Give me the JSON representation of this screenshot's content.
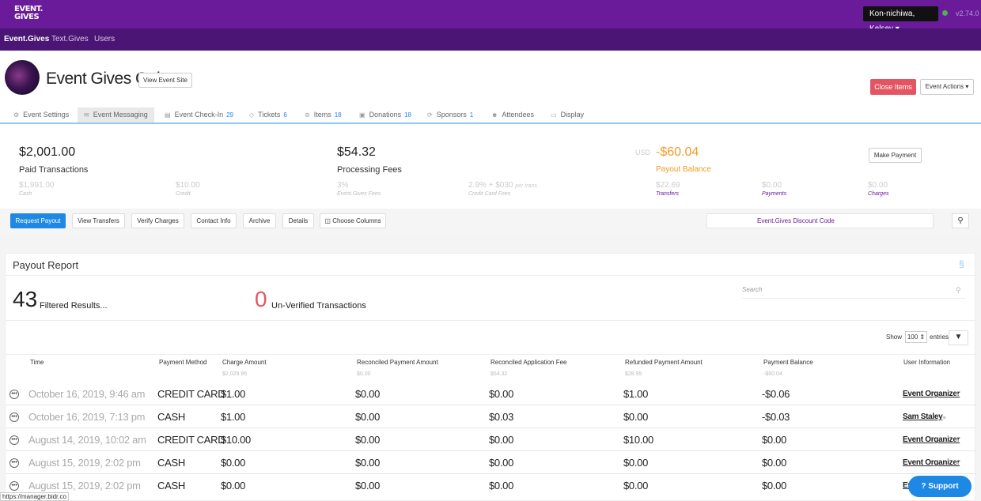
{
  "app": {
    "logo_line1": "EVENT.",
    "logo_line2": "GIVES",
    "user_menu": "Kon-nichiwa, Kelsey ▾",
    "version": "v2.74.0",
    "accent": "#6a1b9a"
  },
  "nav": {
    "items": [
      "Event.Gives",
      "Text.Gives",
      "Users"
    ]
  },
  "event": {
    "title": "Event Gives Gala",
    "view_site": "View Event Site",
    "close_items": "Close Items",
    "event_actions": "Event Actions ▾"
  },
  "tabs": [
    {
      "label": "Event Settings",
      "count": "",
      "icon": "gear-icon"
    },
    {
      "label": "Event Messaging",
      "count": "",
      "icon": "envelope-icon"
    },
    {
      "label": "Event Check-In",
      "count": "29",
      "icon": "checkin-icon"
    },
    {
      "label": "Tickets",
      "count": "6",
      "icon": "tag-icon"
    },
    {
      "label": "Items",
      "count": "18",
      "icon": "items-icon"
    },
    {
      "label": "Donations",
      "count": "18",
      "icon": "donations-icon"
    },
    {
      "label": "Sponsors",
      "count": "1",
      "icon": "handshake-icon"
    },
    {
      "label": "Attendees",
      "count": "",
      "icon": "users-icon"
    },
    {
      "label": "Display",
      "count": "",
      "icon": "monitor-icon"
    }
  ],
  "summary": {
    "paid": {
      "value": "$2,001.00",
      "label": "Paid Transactions",
      "cash": "$1,991.00",
      "cash_lbl": "Cash",
      "credit": "$10.00",
      "credit_lbl": "Credit"
    },
    "fees": {
      "value": "$54.32",
      "label": "Processing Fees",
      "pct": "3%",
      "pct_lbl": "Event.Gives Fees",
      "cc": "2.9% + $030",
      "cc_suffix": "per trans.",
      "cc_lbl": "Credit Card Fees"
    },
    "payout": {
      "currency": "USD",
      "value": "-$60.04",
      "label": "Payout Balance",
      "make_payment": "Make Payment",
      "transfers": "$22.69",
      "transfers_lbl": "Transfers",
      "payments": "$0.00",
      "payments_lbl": "Payments",
      "charges": "$0.00",
      "charges_lbl": "Charges"
    }
  },
  "toolbar": {
    "request_payout": "Request Payout",
    "view_transfers": "View Transfers",
    "verify_charges": "Verify Charges",
    "contact_info": "Contact Info",
    "archive": "Archive",
    "details": "Details",
    "choose_columns": "◫ Choose Columns",
    "discount_code": "Event.Gives Discount Code"
  },
  "report": {
    "title": "Payout Report",
    "filtered_count": "43",
    "filtered_label": "Filtered Results...",
    "unverified_count": "0",
    "unverified_label": "Un-Verified Transactions",
    "search_placeholder": "Search",
    "show_label": "Show",
    "show_value": "100 ⇕",
    "entries_label": "entries",
    "columns": [
      "Time",
      "Payment Method",
      "Charge Amount",
      "Reconciled Payment Amount",
      "Reconciled Application Fee",
      "Refunded Payment Amount",
      "Payment Balance",
      "User Information"
    ],
    "totals": [
      "",
      "",
      "$2,029.95",
      "$0.00",
      "$54.32",
      "$28.95",
      "-$60.04",
      ""
    ],
    "rows": [
      {
        "time": "October 16, 2019, 9:46 am",
        "method": "CREDIT CARD",
        "charge": "$1.00",
        "rec_pay": "$0.00",
        "rec_fee": "$0.00",
        "refund": "$1.00",
        "balance": "-$0.06",
        "user": "Event Organizer"
      },
      {
        "time": "October 16, 2019, 7:13 pm",
        "method": "CASH",
        "charge": "$1.00",
        "rec_pay": "$0.00",
        "rec_fee": "$0.03",
        "refund": "$0.00",
        "balance": "-$0.03",
        "user": "Sam Staley"
      },
      {
        "time": "August 14, 2019, 10:02 am",
        "method": "CREDIT CARD",
        "charge": "$10.00",
        "rec_pay": "$0.00",
        "rec_fee": "$0.00",
        "refund": "$10.00",
        "balance": "$0.00",
        "user": "Event Organizer"
      },
      {
        "time": "August 15, 2019, 2:02 pm",
        "method": "CASH",
        "charge": "$0.00",
        "rec_pay": "$0.00",
        "rec_fee": "$0.00",
        "refund": "$0.00",
        "balance": "$0.00",
        "user": "Event Organizer"
      },
      {
        "time": "August 15, 2019, 2:02 pm",
        "method": "CASH",
        "charge": "$0.00",
        "rec_pay": "$0.00",
        "rec_fee": "$0.00",
        "refund": "$0.00",
        "balance": "$0.00",
        "user": "Ev"
      }
    ]
  },
  "status_url": "https://manager.bidr.co",
  "support_label": "Support"
}
